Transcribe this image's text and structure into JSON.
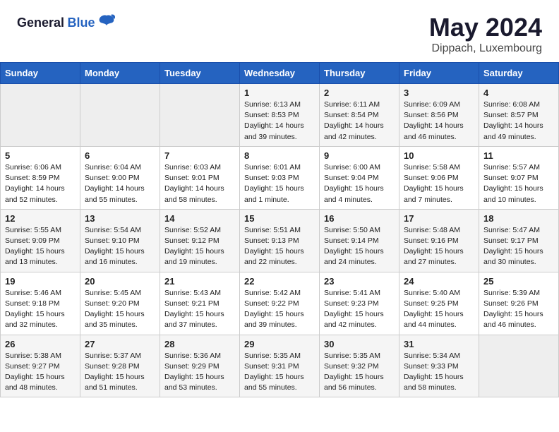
{
  "header": {
    "logo_general": "General",
    "logo_blue": "Blue",
    "title": "May 2024",
    "subtitle": "Dippach, Luxembourg"
  },
  "weekdays": [
    "Sunday",
    "Monday",
    "Tuesday",
    "Wednesday",
    "Thursday",
    "Friday",
    "Saturday"
  ],
  "weeks": [
    [
      {
        "day": "",
        "info": ""
      },
      {
        "day": "",
        "info": ""
      },
      {
        "day": "",
        "info": ""
      },
      {
        "day": "1",
        "info": "Sunrise: 6:13 AM\nSunset: 8:53 PM\nDaylight: 14 hours and 39 minutes."
      },
      {
        "day": "2",
        "info": "Sunrise: 6:11 AM\nSunset: 8:54 PM\nDaylight: 14 hours and 42 minutes."
      },
      {
        "day": "3",
        "info": "Sunrise: 6:09 AM\nSunset: 8:56 PM\nDaylight: 14 hours and 46 minutes."
      },
      {
        "day": "4",
        "info": "Sunrise: 6:08 AM\nSunset: 8:57 PM\nDaylight: 14 hours and 49 minutes."
      }
    ],
    [
      {
        "day": "5",
        "info": "Sunrise: 6:06 AM\nSunset: 8:59 PM\nDaylight: 14 hours and 52 minutes."
      },
      {
        "day": "6",
        "info": "Sunrise: 6:04 AM\nSunset: 9:00 PM\nDaylight: 14 hours and 55 minutes."
      },
      {
        "day": "7",
        "info": "Sunrise: 6:03 AM\nSunset: 9:01 PM\nDaylight: 14 hours and 58 minutes."
      },
      {
        "day": "8",
        "info": "Sunrise: 6:01 AM\nSunset: 9:03 PM\nDaylight: 15 hours and 1 minute."
      },
      {
        "day": "9",
        "info": "Sunrise: 6:00 AM\nSunset: 9:04 PM\nDaylight: 15 hours and 4 minutes."
      },
      {
        "day": "10",
        "info": "Sunrise: 5:58 AM\nSunset: 9:06 PM\nDaylight: 15 hours and 7 minutes."
      },
      {
        "day": "11",
        "info": "Sunrise: 5:57 AM\nSunset: 9:07 PM\nDaylight: 15 hours and 10 minutes."
      }
    ],
    [
      {
        "day": "12",
        "info": "Sunrise: 5:55 AM\nSunset: 9:09 PM\nDaylight: 15 hours and 13 minutes."
      },
      {
        "day": "13",
        "info": "Sunrise: 5:54 AM\nSunset: 9:10 PM\nDaylight: 15 hours and 16 minutes."
      },
      {
        "day": "14",
        "info": "Sunrise: 5:52 AM\nSunset: 9:12 PM\nDaylight: 15 hours and 19 minutes."
      },
      {
        "day": "15",
        "info": "Sunrise: 5:51 AM\nSunset: 9:13 PM\nDaylight: 15 hours and 22 minutes."
      },
      {
        "day": "16",
        "info": "Sunrise: 5:50 AM\nSunset: 9:14 PM\nDaylight: 15 hours and 24 minutes."
      },
      {
        "day": "17",
        "info": "Sunrise: 5:48 AM\nSunset: 9:16 PM\nDaylight: 15 hours and 27 minutes."
      },
      {
        "day": "18",
        "info": "Sunrise: 5:47 AM\nSunset: 9:17 PM\nDaylight: 15 hours and 30 minutes."
      }
    ],
    [
      {
        "day": "19",
        "info": "Sunrise: 5:46 AM\nSunset: 9:18 PM\nDaylight: 15 hours and 32 minutes."
      },
      {
        "day": "20",
        "info": "Sunrise: 5:45 AM\nSunset: 9:20 PM\nDaylight: 15 hours and 35 minutes."
      },
      {
        "day": "21",
        "info": "Sunrise: 5:43 AM\nSunset: 9:21 PM\nDaylight: 15 hours and 37 minutes."
      },
      {
        "day": "22",
        "info": "Sunrise: 5:42 AM\nSunset: 9:22 PM\nDaylight: 15 hours and 39 minutes."
      },
      {
        "day": "23",
        "info": "Sunrise: 5:41 AM\nSunset: 9:23 PM\nDaylight: 15 hours and 42 minutes."
      },
      {
        "day": "24",
        "info": "Sunrise: 5:40 AM\nSunset: 9:25 PM\nDaylight: 15 hours and 44 minutes."
      },
      {
        "day": "25",
        "info": "Sunrise: 5:39 AM\nSunset: 9:26 PM\nDaylight: 15 hours and 46 minutes."
      }
    ],
    [
      {
        "day": "26",
        "info": "Sunrise: 5:38 AM\nSunset: 9:27 PM\nDaylight: 15 hours and 48 minutes."
      },
      {
        "day": "27",
        "info": "Sunrise: 5:37 AM\nSunset: 9:28 PM\nDaylight: 15 hours and 51 minutes."
      },
      {
        "day": "28",
        "info": "Sunrise: 5:36 AM\nSunset: 9:29 PM\nDaylight: 15 hours and 53 minutes."
      },
      {
        "day": "29",
        "info": "Sunrise: 5:35 AM\nSunset: 9:31 PM\nDaylight: 15 hours and 55 minutes."
      },
      {
        "day": "30",
        "info": "Sunrise: 5:35 AM\nSunset: 9:32 PM\nDaylight: 15 hours and 56 minutes."
      },
      {
        "day": "31",
        "info": "Sunrise: 5:34 AM\nSunset: 9:33 PM\nDaylight: 15 hours and 58 minutes."
      },
      {
        "day": "",
        "info": ""
      }
    ]
  ]
}
